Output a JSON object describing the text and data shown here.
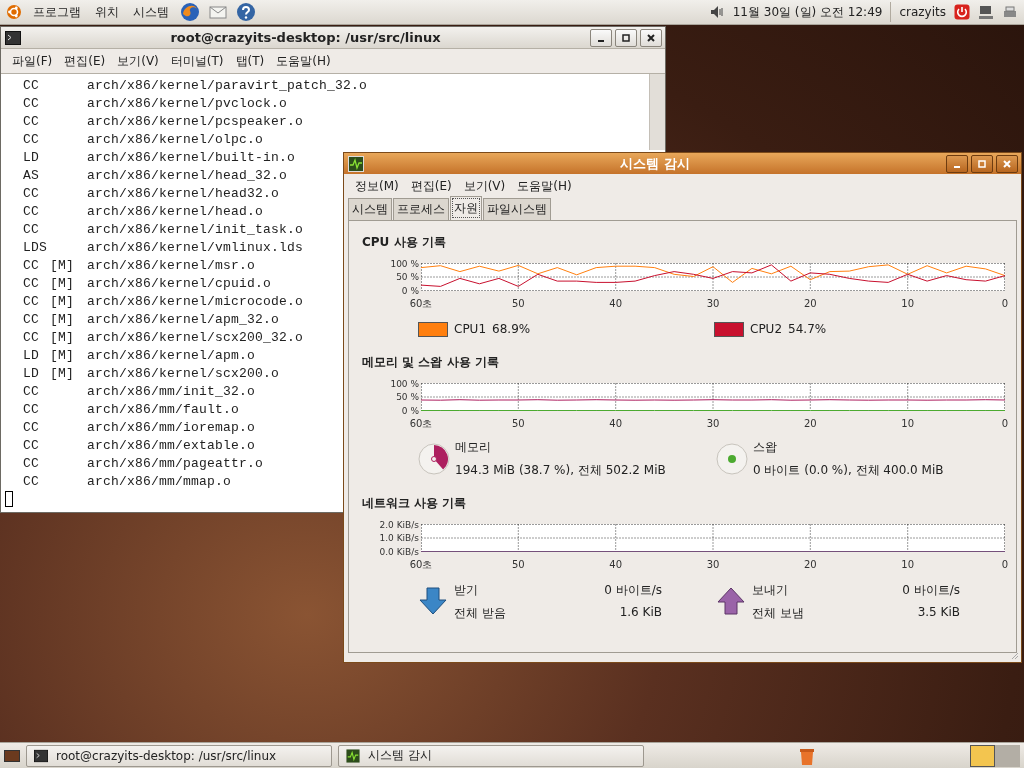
{
  "top_panel": {
    "menus": [
      "프로그램",
      "위치",
      "시스템"
    ],
    "clock": "11월 30일 (일) 오전 12:49",
    "user": "crazyits"
  },
  "terminal": {
    "title": "root@crazyits-desktop: /usr/src/linux",
    "menus": [
      "파일(F)",
      "편집(E)",
      "보기(V)",
      "터미널(T)",
      "탭(T)",
      "도움말(H)"
    ],
    "lines": [
      {
        "action": "CC",
        "path": "arch/x86/kernel/paravirt_patch_32.o"
      },
      {
        "action": "CC",
        "path": "arch/x86/kernel/pvclock.o"
      },
      {
        "action": "CC",
        "path": "arch/x86/kernel/pcspeaker.o"
      },
      {
        "action": "CC",
        "path": "arch/x86/kernel/olpc.o"
      },
      {
        "action": "LD",
        "path": "arch/x86/kernel/built-in.o"
      },
      {
        "action": "AS",
        "path": "arch/x86/kernel/head_32.o"
      },
      {
        "action": "CC",
        "path": "arch/x86/kernel/head32.o"
      },
      {
        "action": "CC",
        "path": "arch/x86/kernel/head.o"
      },
      {
        "action": "CC",
        "path": "arch/x86/kernel/init_task.o"
      },
      {
        "action": "LDS",
        "path": "arch/x86/kernel/vmlinux.lds"
      },
      {
        "action": "CC",
        "module": "[M]",
        "path": "arch/x86/kernel/msr.o"
      },
      {
        "action": "CC",
        "module": "[M]",
        "path": "arch/x86/kernel/cpuid.o"
      },
      {
        "action": "CC",
        "module": "[M]",
        "path": "arch/x86/kernel/microcode.o"
      },
      {
        "action": "CC",
        "module": "[M]",
        "path": "arch/x86/kernel/apm_32.o"
      },
      {
        "action": "CC",
        "module": "[M]",
        "path": "arch/x86/kernel/scx200_32.o"
      },
      {
        "action": "LD",
        "module": "[M]",
        "path": "arch/x86/kernel/apm.o"
      },
      {
        "action": "LD",
        "module": "[M]",
        "path": "arch/x86/kernel/scx200.o"
      },
      {
        "action": "CC",
        "path": "arch/x86/mm/init_32.o"
      },
      {
        "action": "CC",
        "path": "arch/x86/mm/fault.o"
      },
      {
        "action": "CC",
        "path": "arch/x86/mm/ioremap.o"
      },
      {
        "action": "CC",
        "path": "arch/x86/mm/extable.o"
      },
      {
        "action": "CC",
        "path": "arch/x86/mm/pageattr.o"
      },
      {
        "action": "CC",
        "path": "arch/x86/mm/mmap.o"
      }
    ]
  },
  "monitor": {
    "title": "시스템 감시",
    "menus": [
      "정보(M)",
      "편집(E)",
      "보기(V)",
      "도움말(H)"
    ],
    "tabs": [
      {
        "label": "시스템",
        "selected": false
      },
      {
        "label": "프로세스",
        "selected": false
      },
      {
        "label": "자원",
        "selected": true
      },
      {
        "label": "파일시스템",
        "selected": false
      }
    ],
    "cpu": {
      "heading": "CPU 사용 기록",
      "chart_data": {
        "type": "line",
        "grid": true,
        "xlim": [
          60,
          0
        ],
        "ylim": [
          0,
          100
        ],
        "xticks": [
          {
            "value": 60,
            "label": "60초"
          },
          {
            "value": 50,
            "label": "50"
          },
          {
            "value": 40,
            "label": "40"
          },
          {
            "value": 30,
            "label": "30"
          },
          {
            "value": 20,
            "label": "20"
          },
          {
            "value": 10,
            "label": "10"
          },
          {
            "value": 0,
            "label": "0"
          }
        ],
        "yticks": [
          {
            "value": 100,
            "label": "100 %"
          },
          {
            "value": 50,
            "label": "50 %"
          },
          {
            "value": 0,
            "label": "0 %"
          }
        ],
        "x": [
          60,
          58,
          56,
          54,
          52,
          50,
          48,
          46,
          44,
          42,
          40,
          38,
          36,
          34,
          32,
          30,
          28,
          26,
          24,
          22,
          20,
          18,
          16,
          14,
          12,
          10,
          8,
          6,
          4,
          2,
          0
        ],
        "series": [
          {
            "name": "CPU1",
            "color": "#ff7f0f",
            "values": [
              85,
              92,
              70,
              90,
              72,
              93,
              62,
              85,
              58,
              85,
              90,
              90,
              85,
              60,
              52,
              88,
              30,
              82,
              62,
              90,
              40,
              70,
              72,
              88,
              95,
              60,
              92,
              65,
              90,
              80,
              55
            ]
          },
          {
            "name": "CPU2",
            "color": "#c8102e",
            "values": [
              20,
              15,
              45,
              25,
              45,
              15,
              60,
              35,
              35,
              30,
              30,
              35,
              55,
              70,
              60,
              45,
              70,
              65,
              95,
              35,
              65,
              60,
              45,
              35,
              30,
              60,
              35,
              55,
              40,
              35,
              55
            ]
          }
        ]
      },
      "readings": [
        "68.9%",
        "54.7%"
      ]
    },
    "memory": {
      "heading": "메모리 및 스왑 사용 기록",
      "chart_data": {
        "type": "line",
        "grid": true,
        "xlim": [
          60,
          0
        ],
        "ylim": [
          0,
          100
        ],
        "xticks": [
          {
            "value": 60,
            "label": "60초"
          },
          {
            "value": 50,
            "label": "50"
          },
          {
            "value": 40,
            "label": "40"
          },
          {
            "value": 30,
            "label": "30"
          },
          {
            "value": 20,
            "label": "20"
          },
          {
            "value": 10,
            "label": "10"
          },
          {
            "value": 0,
            "label": "0"
          }
        ],
        "yticks": [
          {
            "value": 100,
            "label": "100 %"
          },
          {
            "value": 50,
            "label": "50 %"
          },
          {
            "value": 0,
            "label": "0 %"
          }
        ],
        "x": [
          60,
          58,
          56,
          54,
          52,
          50,
          48,
          46,
          44,
          42,
          40,
          38,
          36,
          34,
          32,
          30,
          28,
          26,
          24,
          22,
          20,
          18,
          16,
          14,
          12,
          10,
          8,
          6,
          4,
          2,
          0
        ],
        "series": [
          {
            "color": "#ad1f5f",
            "values": [
              39,
              38,
              40,
              38,
              39,
              39,
              40,
              38,
              39,
              40,
              39,
              38,
              39,
              38,
              39,
              40,
              39,
              39,
              40,
              38,
              39,
              40,
              39,
              38,
              39,
              39,
              38,
              39,
              39,
              40,
              39
            ]
          },
          {
            "color": "#4caa30",
            "values": [
              0,
              0,
              0,
              0,
              0,
              0,
              0,
              0,
              0,
              0,
              0,
              0,
              0,
              0,
              0,
              0,
              0,
              0,
              0,
              0,
              0,
              0,
              0,
              0,
              0,
              0,
              0,
              0,
              0,
              0,
              0
            ]
          }
        ]
      },
      "gauges": [
        {
          "label": "메모리",
          "detail": "194.3 MiB (38.7 %), 전체 502.2 MiB",
          "level": 0.387,
          "color": "#ad1f5f"
        },
        {
          "label": "스왑",
          "detail": "0 바이트 (0.0 %), 전체 400.0 MiB",
          "color": "#4caa30"
        }
      ]
    },
    "network": {
      "heading": "네트워크 사용 기록",
      "chart_data": {
        "type": "line",
        "grid": true,
        "xlim": [
          60,
          0
        ],
        "ylim": [
          0,
          2
        ],
        "xticks": [
          {
            "value": 60,
            "label": "60초"
          },
          {
            "value": 50,
            "label": "50"
          },
          {
            "value": 40,
            "label": "40"
          },
          {
            "value": 30,
            "label": "30"
          },
          {
            "value": 20,
            "label": "20"
          },
          {
            "value": 10,
            "label": "10"
          },
          {
            "value": 0,
            "label": "0"
          }
        ],
        "yticks": [
          {
            "value": 2,
            "label": "2.0 KiB/s"
          },
          {
            "value": 1,
            "label": "1.0 KiB/s"
          },
          {
            "value": 0,
            "label": "0.0 KiB/s"
          }
        ],
        "x": [
          60,
          0
        ],
        "series": [
          {
            "color": "#75507b",
            "values": [
              0,
              0
            ]
          }
        ]
      },
      "stats": [
        {
          "kind": "receive",
          "label": "받기",
          "rate": "0 바이트/s",
          "total_label": "전체 받음",
          "total": "1.6 KiB"
        },
        {
          "kind": "send",
          "label": "보내기",
          "rate": "0 바이트/s",
          "total_label": "전체 보냄",
          "total": "3.5 KiB"
        }
      ]
    }
  },
  "taskbar": {
    "tasks": [
      {
        "kind": "terminal",
        "label": "root@crazyits-desktop: /usr/src/linux"
      },
      {
        "kind": "monitor",
        "label": "시스템 감시"
      }
    ]
  }
}
